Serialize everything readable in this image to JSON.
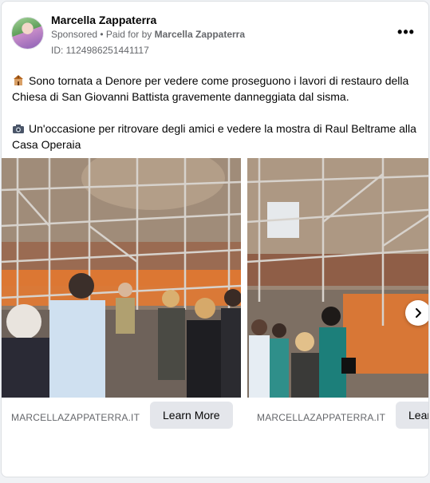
{
  "post": {
    "author": "Marcella Zappaterra",
    "sponsored_label": "Sponsored",
    "paid_prefix": " • Paid for by ",
    "paid_by": "Marcella Zappaterra",
    "ad_id": "ID: 1124986251441117",
    "more_label": "•••",
    "paragraphs": [
      "Sono tornata a Denore per vedere come proseguono i lavori di restauro della Chiesa di San Giovanni Battista gravemente danneggiata dal sisma.",
      "Un'occasione per ritrovare degli amici e vedere la mostra di Raul Beltrame alla Casa Operaia"
    ],
    "emoji_icons": [
      "church-icon",
      "camera-icon"
    ]
  },
  "carousel": {
    "cards": [
      {
        "domain": "MARCELLAZAPPATERRA.IT",
        "cta": "Learn More"
      },
      {
        "domain": "MARCELLAZAPPATERRA.IT",
        "cta": "Learn More"
      }
    ],
    "next_icon": "chevron-right-icon"
  },
  "colors": {
    "text": "#050505",
    "secondary": "#65676b",
    "button_bg": "#e4e6eb",
    "fence": "#e8792e"
  }
}
